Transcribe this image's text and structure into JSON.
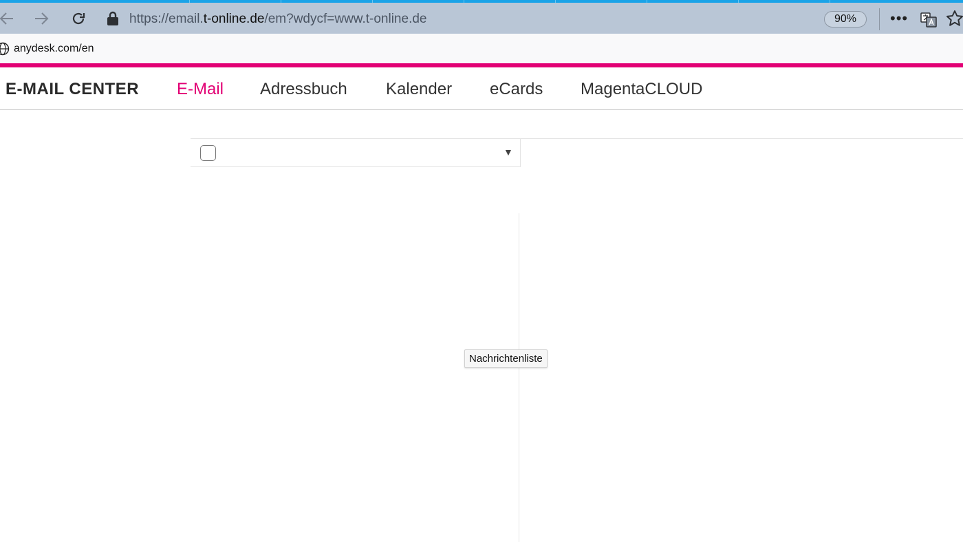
{
  "browser": {
    "url_prefix": "https://email.",
    "url_host": "t-online.de",
    "url_path": "/em?wdycf=www.t-online.de",
    "zoom": "90%",
    "more_label": "•••",
    "icons": {
      "back": "arrow-left-icon",
      "forward": "arrow-right-icon",
      "reload": "reload-icon",
      "lock": "lock-icon",
      "translate": "translate-icon",
      "star": "star-icon"
    }
  },
  "bookmarks": {
    "items": [
      {
        "label": "anydesk.com/en",
        "icon": "globe-icon"
      }
    ]
  },
  "app": {
    "brand": "E-MAIL CENTER",
    "nav": [
      {
        "label": "E-Mail",
        "active": true
      },
      {
        "label": "Adressbuch",
        "active": false
      },
      {
        "label": "Kalender",
        "active": false
      },
      {
        "label": "eCards",
        "active": false
      },
      {
        "label": "MagentaCLOUD",
        "active": false
      }
    ],
    "accent_color": "#e20074"
  },
  "mail": {
    "dropdown_arrow": "▼",
    "tooltip": "Nachrichtenliste"
  }
}
